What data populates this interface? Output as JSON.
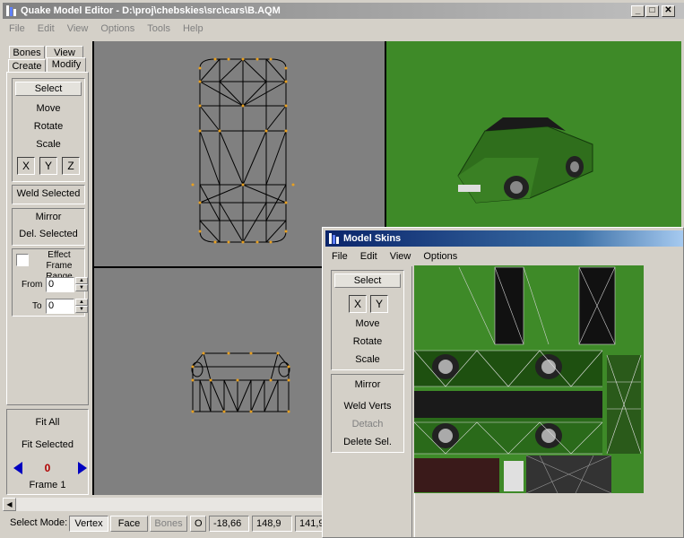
{
  "main_window": {
    "title": "Quake Model Editor - D:\\proj\\chebskies\\src\\cars\\B.AQM",
    "menu": [
      "File",
      "Edit",
      "View",
      "Options",
      "Tools",
      "Help"
    ],
    "controls": {
      "minimize": "_",
      "maximize": "□",
      "close": "✕"
    }
  },
  "left_panel": {
    "tabs_row1": [
      "Bones",
      "View"
    ],
    "tabs_row2": [
      "Create",
      "Modify"
    ],
    "select": "Select",
    "move": "Move",
    "rotate": "Rotate",
    "scale": "Scale",
    "axes": [
      "X",
      "Y",
      "Z"
    ],
    "weld_selected": "Weld Selected",
    "mirror": "Mirror",
    "del_selected": "Del. Selected",
    "effect_frame_range": "Effect Frame Range",
    "effect_checked": false,
    "from_label": "From",
    "from_value": "0",
    "to_label": "To",
    "to_value": "0",
    "fit_all": "Fit All",
    "fit_selected": "Fit Selected",
    "frame_number": "0",
    "frame_label": "Frame 1"
  },
  "status_bar": {
    "select_mode_label": "Select Mode:",
    "modes": [
      "Vertex",
      "Face",
      "Bones"
    ],
    "o_button": "O",
    "coords": [
      "-18,66",
      "148,9",
      "141,9"
    ]
  },
  "skins_window": {
    "title": "Model Skins",
    "menu": [
      "File",
      "Edit",
      "View",
      "Options"
    ],
    "select": "Select",
    "axes": [
      "X",
      "Y"
    ],
    "move": "Move",
    "rotate": "Rotate",
    "scale": "Scale",
    "mirror": "Mirror",
    "weld_verts": "Weld Verts",
    "detach": "Detach",
    "delete_sel": "Delete Sel."
  },
  "colors": {
    "title_active": "#0a246a",
    "title_active_end": "#a6caf0",
    "title_inactive": "#808080",
    "viewport_gray": "#808080",
    "viewport_green": "#3e8a28",
    "vertex_orange": "#e8a020",
    "frame_number_red": "#b00000",
    "arrow_blue": "#0000c0"
  }
}
